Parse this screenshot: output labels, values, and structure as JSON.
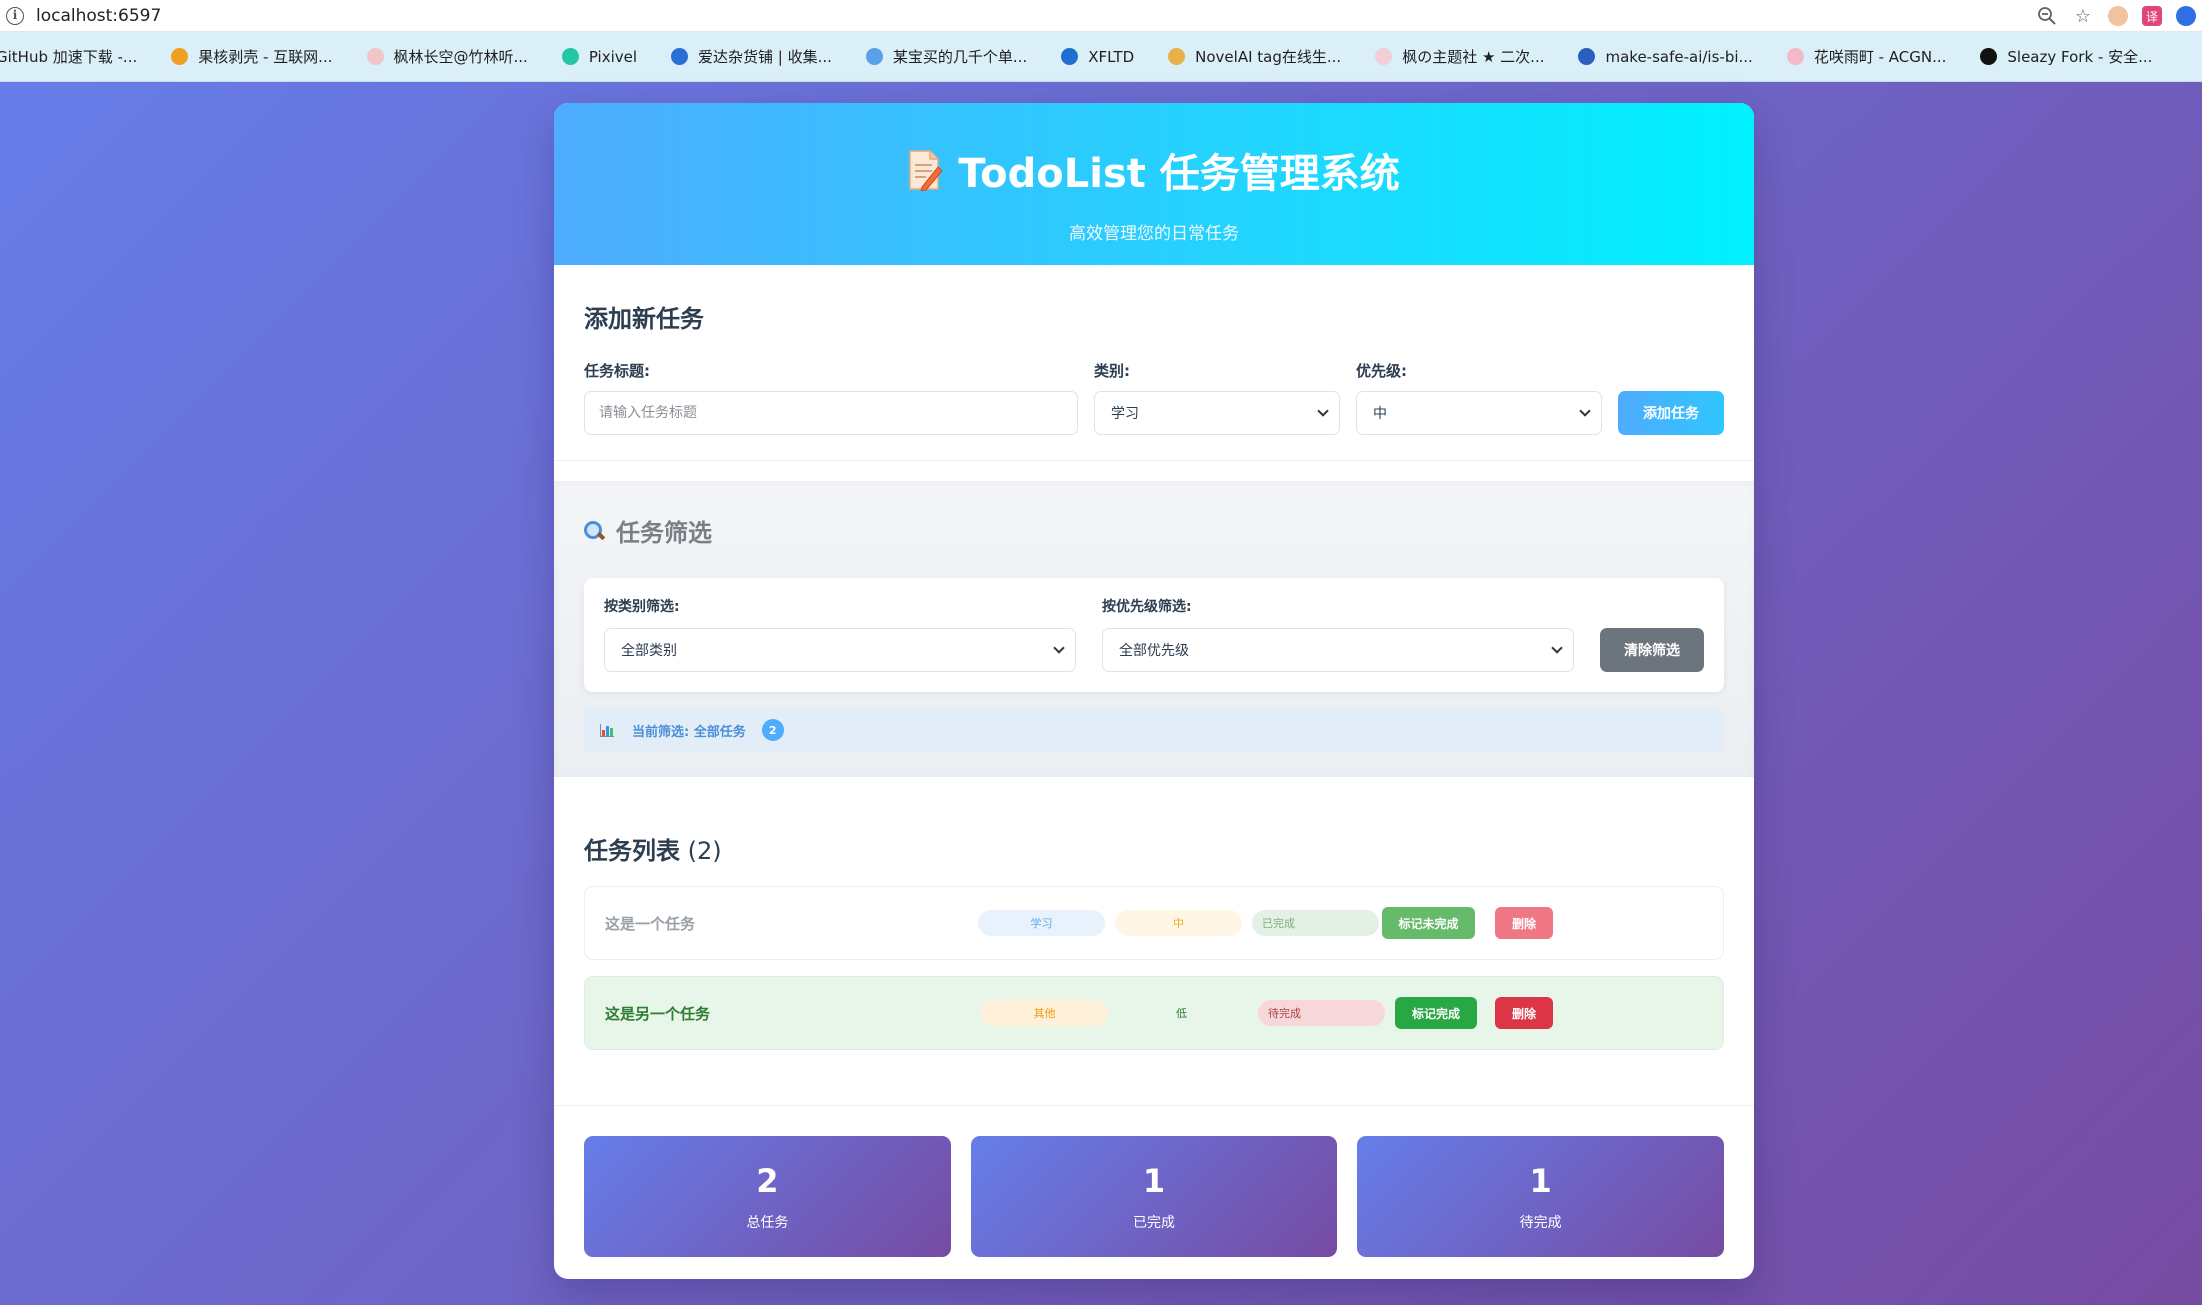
{
  "browser": {
    "url": "localhost:6597",
    "bookmarks": [
      {
        "label": "GitHub 加速下载 -...",
        "color": "#333333"
      },
      {
        "label": "果核剥壳 - 互联网...",
        "color": "#f0a020"
      },
      {
        "label": "枫林长空@竹林听...",
        "color": "#f2c6c6"
      },
      {
        "label": "Pixivel",
        "color": "#24c6a4"
      },
      {
        "label": "爱达杂货铺 | 收集...",
        "color": "#2a6fd6"
      },
      {
        "label": "某宝买的几千个单...",
        "color": "#5aa0e6"
      },
      {
        "label": "XFLTD",
        "color": "#1e6fd0"
      },
      {
        "label": "NovelAI tag在线生...",
        "color": "#e8b04a"
      },
      {
        "label": "枫の主题社 ★ 二次...",
        "color": "#f0d0d6"
      },
      {
        "label": "make-safe-ai/is-bi...",
        "color": "#2a5fc0"
      },
      {
        "label": "花咲雨町 - ACGN...",
        "color": "#f4b8c8"
      },
      {
        "label": "Sleazy Fork - 安全...",
        "color": "#111111"
      }
    ],
    "icons": [
      "zoom-out-icon",
      "star-icon"
    ],
    "ext_label": "译"
  },
  "app": {
    "title": "TodoList 任务管理系统",
    "subtitle": "高效管理您的日常任务"
  },
  "add": {
    "heading": "添加新任务",
    "title_label": "任务标题:",
    "title_placeholder": "请输入任务标题",
    "title_value": "",
    "category_label": "类别:",
    "category_value": "学习",
    "priority_label": "优先级:",
    "priority_value": "中",
    "button": "添加任务"
  },
  "filter": {
    "heading": "任务筛选",
    "category_label": "按类别筛选:",
    "category_value": "全部类别",
    "priority_label": "按优先级筛选:",
    "priority_value": "全部优先级",
    "clear_button": "清除筛选",
    "status_text": "当前筛选: 全部任务",
    "status_count": "2"
  },
  "list": {
    "heading": "任务列表",
    "count": "(2)",
    "tasks": [
      {
        "title": "这是一个任务",
        "category": "学习",
        "priority": "中",
        "status": "已完成",
        "toggle": "标记未完成",
        "delete": "删除"
      },
      {
        "title": "这是另一个任务",
        "category": "其他",
        "priority": "低",
        "status": "待完成",
        "toggle": "标记完成",
        "delete": "删除"
      }
    ]
  },
  "stats": [
    {
      "value": "2",
      "label": "总任务"
    },
    {
      "value": "1",
      "label": "已完成"
    },
    {
      "value": "1",
      "label": "待完成"
    }
  ],
  "colors": {
    "header_gradient": [
      "#4facfe",
      "#00f2fe"
    ],
    "page_gradient": [
      "#667eea",
      "#764ba2"
    ],
    "done_green": "#66bb6a",
    "pending_green": "#28a745",
    "delete_red": "#dc3545"
  }
}
